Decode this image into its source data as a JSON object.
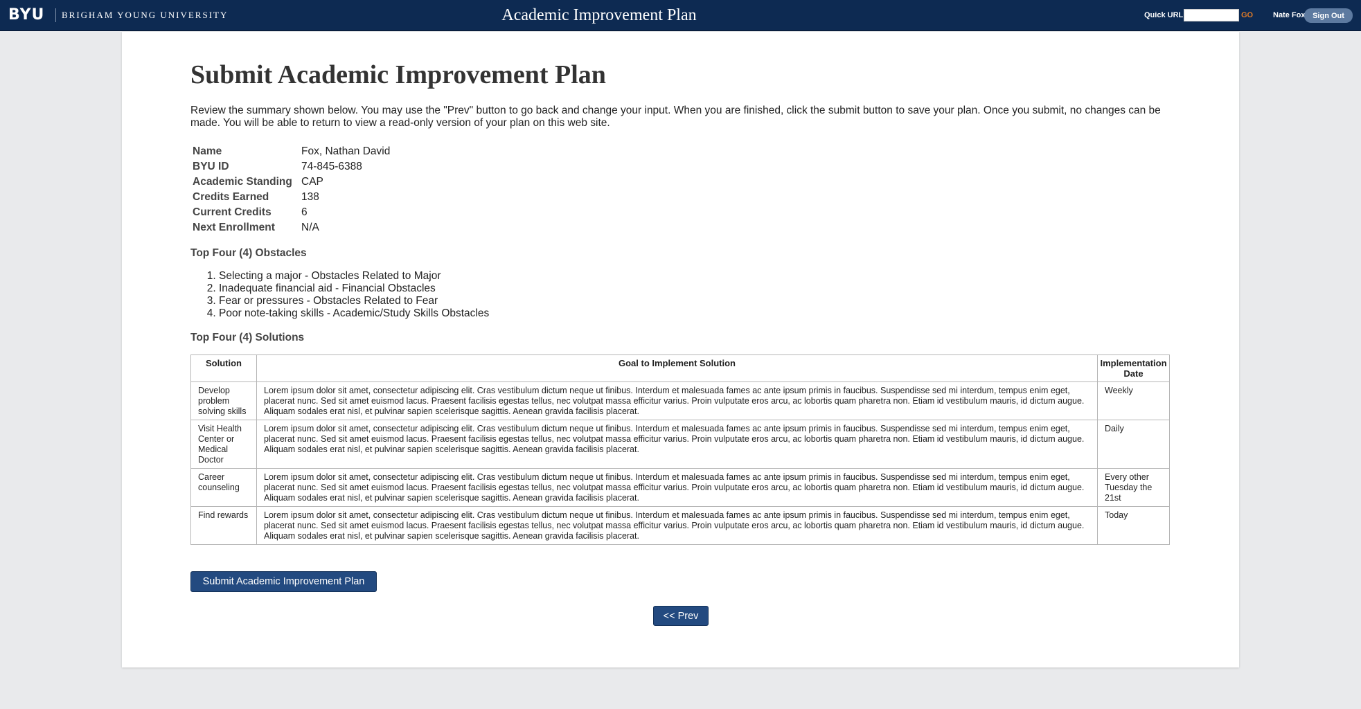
{
  "header": {
    "logo": "BYU",
    "logo_subtitle": "BRIGHAM YOUNG UNIVERSITY",
    "app_title": "Academic Improvement Plan",
    "quick_url_label": "Quick URL",
    "quick_url_value": "",
    "go_label": "GO",
    "user_name": "Nate Fox",
    "sign_out_label": "Sign Out",
    "colors": {
      "bar": "#0d2a52",
      "go": "#e07b27"
    }
  },
  "main": {
    "title": "Submit Academic Improvement Plan",
    "intro": "Review the summary shown below. You may use the \"Prev\" button to go back and change your input. When you are finished, click the submit button to save your plan. Once you submit, no changes can be made. You will be able to return to view a read-only version of your plan on this web site.",
    "student_info": [
      {
        "label": "Name",
        "value": "Fox, Nathan David"
      },
      {
        "label": "BYU ID",
        "value": "74-845-6388"
      },
      {
        "label": "Academic Standing",
        "value": "CAP"
      },
      {
        "label": "Credits Earned",
        "value": "138"
      },
      {
        "label": "Current Credits",
        "value": "6"
      },
      {
        "label": "Next Enrollment",
        "value": "N/A"
      }
    ],
    "obstacles_heading": "Top Four (4) Obstacles",
    "obstacles": [
      "Selecting a major - Obstacles Related to Major",
      "Inadequate financial aid - Financial Obstacles",
      "Fear or pressures - Obstacles Related to Fear",
      "Poor note-taking skills - Academic/Study Skills Obstacles"
    ],
    "solutions_heading": "Top Four (4) Solutions",
    "solutions_columns": [
      "Solution",
      "Goal to Implement Solution",
      "Implementation Date"
    ],
    "solutions": [
      {
        "solution": "Develop problem solving skills",
        "goal": "Lorem ipsum dolor sit amet, consectetur adipiscing elit. Cras vestibulum dictum neque ut finibus. Interdum et malesuada fames ac ante ipsum primis in faucibus. Suspendisse sed mi interdum, tempus enim eget, placerat nunc. Sed sit amet euismod lacus. Praesent facilisis egestas tellus, nec volutpat massa efficitur varius. Proin vulputate eros arcu, ac lobortis quam pharetra non. Etiam id vestibulum mauris, id dictum augue. Aliquam sodales erat nisl, et pulvinar sapien scelerisque sagittis. Aenean gravida facilisis placerat.",
        "date": "Weekly"
      },
      {
        "solution": "Visit Health Center or Medical Doctor",
        "goal": "Lorem ipsum dolor sit amet, consectetur adipiscing elit. Cras vestibulum dictum neque ut finibus. Interdum et malesuada fames ac ante ipsum primis in faucibus. Suspendisse sed mi interdum, tempus enim eget, placerat nunc. Sed sit amet euismod lacus. Praesent facilisis egestas tellus, nec volutpat massa efficitur varius. Proin vulputate eros arcu, ac lobortis quam pharetra non. Etiam id vestibulum mauris, id dictum augue. Aliquam sodales erat nisl, et pulvinar sapien scelerisque sagittis. Aenean gravida facilisis placerat.",
        "date": "Daily"
      },
      {
        "solution": "Career counseling",
        "goal": "Lorem ipsum dolor sit amet, consectetur adipiscing elit. Cras vestibulum dictum neque ut finibus. Interdum et malesuada fames ac ante ipsum primis in faucibus. Suspendisse sed mi interdum, tempus enim eget, placerat nunc. Sed sit amet euismod lacus. Praesent facilisis egestas tellus, nec volutpat massa efficitur varius. Proin vulputate eros arcu, ac lobortis quam pharetra non. Etiam id vestibulum mauris, id dictum augue. Aliquam sodales erat nisl, et pulvinar sapien scelerisque sagittis. Aenean gravida facilisis placerat.",
        "date": "Every other Tuesday the 21st"
      },
      {
        "solution": "Find rewards",
        "goal": "Lorem ipsum dolor sit amet, consectetur adipiscing elit. Cras vestibulum dictum neque ut finibus. Interdum et malesuada fames ac ante ipsum primis in faucibus. Suspendisse sed mi interdum, tempus enim eget, placerat nunc. Sed sit amet euismod lacus. Praesent facilisis egestas tellus, nec volutpat massa efficitur varius. Proin vulputate eros arcu, ac lobortis quam pharetra non. Etiam id vestibulum mauris, id dictum augue. Aliquam sodales erat nisl, et pulvinar sapien scelerisque sagittis. Aenean gravida facilisis placerat.",
        "date": "Today"
      }
    ],
    "submit_label": "Submit Academic Improvement Plan",
    "prev_label": "<< Prev",
    "colors": {
      "button": "#234a80"
    }
  }
}
